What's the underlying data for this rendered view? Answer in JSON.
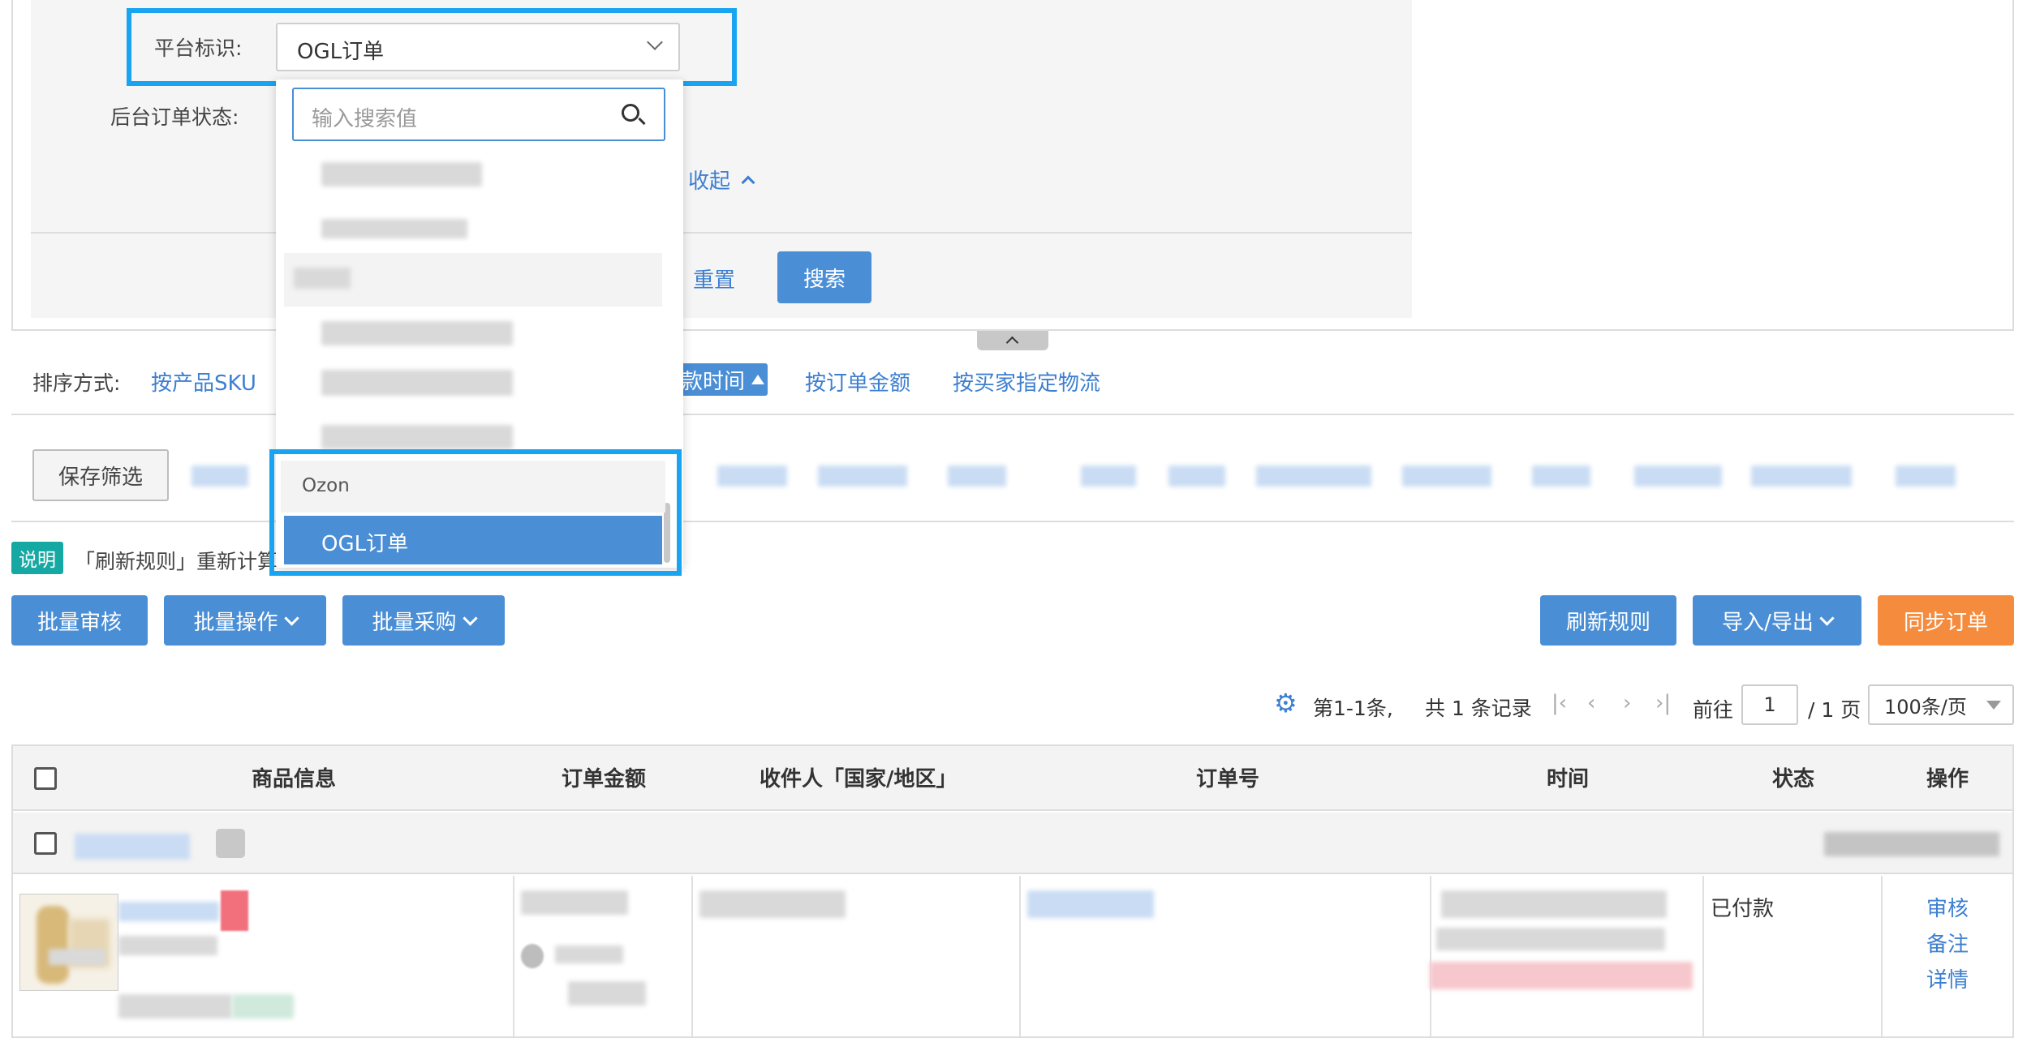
{
  "filter": {
    "platform_label": "平台标识:",
    "platform_value": "OGL订单",
    "status_label": "后台订单状态:",
    "collapse_link": "收起",
    "reset_button": "重置",
    "search_button": "搜索"
  },
  "dropdown": {
    "search_placeholder": "输入搜索值",
    "group_label": "Ozon",
    "selected_option": "OGL订单"
  },
  "sort": {
    "label": "排序方式:",
    "by_sku": "按产品SKU",
    "by_pay_time": "款时间",
    "by_amount": "按订单金额",
    "by_logistics": "按买家指定物流"
  },
  "saved_filter_button": "保存筛选",
  "notice": {
    "badge": "说明",
    "text": "「刷新规则」重新计算"
  },
  "toolbar": {
    "batch_review": "批量审核",
    "batch_operate": "批量操作",
    "batch_purchase": "批量采购",
    "refresh_rules": "刷新规则",
    "import_export": "导入/导出",
    "sync_orders": "同步订单"
  },
  "pagination": {
    "range": "第1-1条,",
    "total": "共 1 条记录",
    "goto_label": "前往",
    "page_value": "1",
    "page_total": "/ 1 页",
    "page_size": "100条/页"
  },
  "table": {
    "headers": [
      "商品信息",
      "订单金额",
      "收件人「国家/地区」",
      "订单号",
      "时间",
      "状态",
      "操作"
    ],
    "row": {
      "status": "已付款",
      "actions": [
        "审核",
        "备注",
        "详情"
      ]
    }
  },
  "colors": {
    "primary": "#4a8ed6",
    "orange": "#f58b3c",
    "highlight": "#19a4f2",
    "teal_badge": "#16a9a4"
  }
}
